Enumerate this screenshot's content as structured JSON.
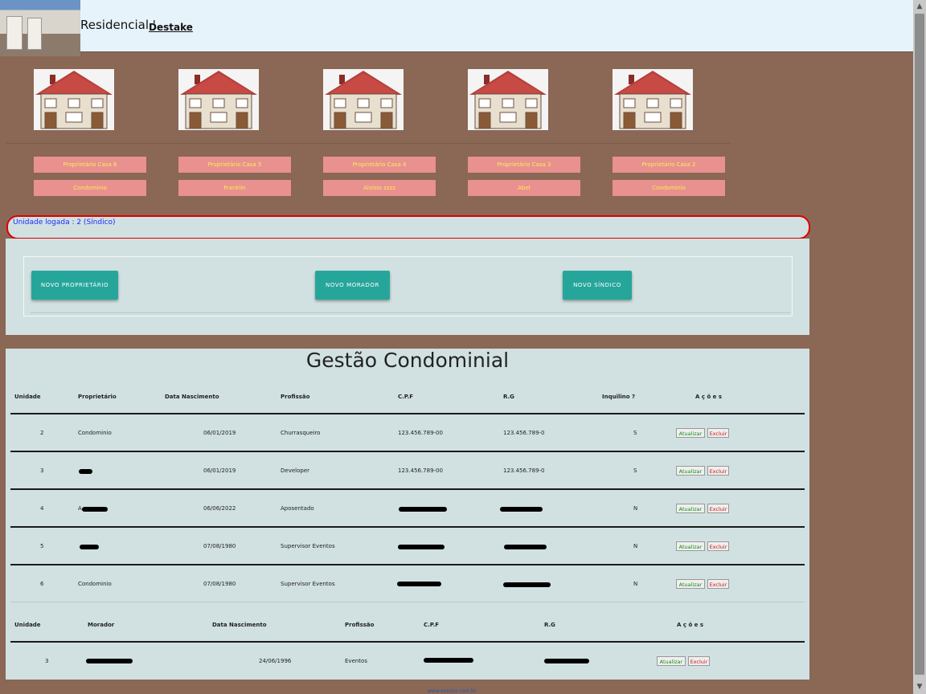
{
  "header": {
    "title": "Residencial '",
    "link_label": "Destake"
  },
  "houses": [
    "house-icon",
    "house-icon",
    "house-icon",
    "house-icon",
    "house-icon"
  ],
  "owner_buttons": [
    "Proprietário Casa 6",
    "Proprietário Casa 5",
    "Proprietário Casa 4",
    "Proprietário Casa 3",
    "Proprietário Casa 2"
  ],
  "resident_buttons": [
    "Condomínio",
    "Franklin",
    "Aloisio zzzz",
    "Abel",
    "Condominio"
  ],
  "status": {
    "text": "Unidade logada : 2 (Síndico)"
  },
  "actions": {
    "new_owner": "NOVO PROPRIETÁRIO",
    "new_resident": "NOVO MORADOR",
    "new_manager": "NOVO SÍNDICO"
  },
  "owners_table": {
    "title": "Gestão Condominial",
    "headers": [
      "Unidade",
      "Proprietário",
      "Data Nascimento",
      "Profissão",
      "C.P.F",
      "R.G",
      "Inquilino ?",
      "A ç õ e s"
    ],
    "rows": [
      {
        "unit": "2",
        "owner": "Condominio",
        "birth": "06/01/2019",
        "job": "Churrasqueiro",
        "cpf": "123.456.789-00",
        "rg": "123.456.789-0",
        "tenant": "S"
      },
      {
        "unit": "3",
        "owner": "",
        "birth": "06/01/2019",
        "job": "Developer",
        "cpf": "123.456.789-00",
        "rg": "123.456.789-0",
        "tenant": "S"
      },
      {
        "unit": "4",
        "owner": "A",
        "birth": "06/06/2022",
        "job": "Aposentado",
        "cpf": "",
        "rg": "",
        "tenant": "N"
      },
      {
        "unit": "5",
        "owner": "",
        "birth": "07/08/1980",
        "job": "Supervisor Eventos",
        "cpf": "",
        "rg": "",
        "tenant": "N"
      },
      {
        "unit": "6",
        "owner": "Condominio",
        "birth": "07/08/1980",
        "job": "Supervisor Eventos",
        "cpf": "",
        "rg": "",
        "tenant": "N"
      }
    ],
    "update_label": "Atualizar",
    "delete_label": "Excluir"
  },
  "residents_table": {
    "headers": [
      "Unidade",
      "Morador",
      "Data Nascimento",
      "Profissão",
      "C.P.F",
      "R.G",
      "A ç õ e s"
    ],
    "rows": [
      {
        "unit": "3",
        "name": "",
        "birth": "24/06/1996",
        "job": "Eventos",
        "cpf": "",
        "rg": ""
      }
    ],
    "update_label": "Atualizar",
    "delete_label": "Excluir"
  },
  "footer": {
    "text": "www.xxxxxx.com.br"
  },
  "colors": {
    "background": "#8b6755",
    "panel": "#d1e1e1",
    "pink_button": "#e8918e",
    "pink_text": "#ffe95a",
    "teal_button": "#26a69a",
    "status_border": "#e00000",
    "status_text": "#1a2cff"
  }
}
